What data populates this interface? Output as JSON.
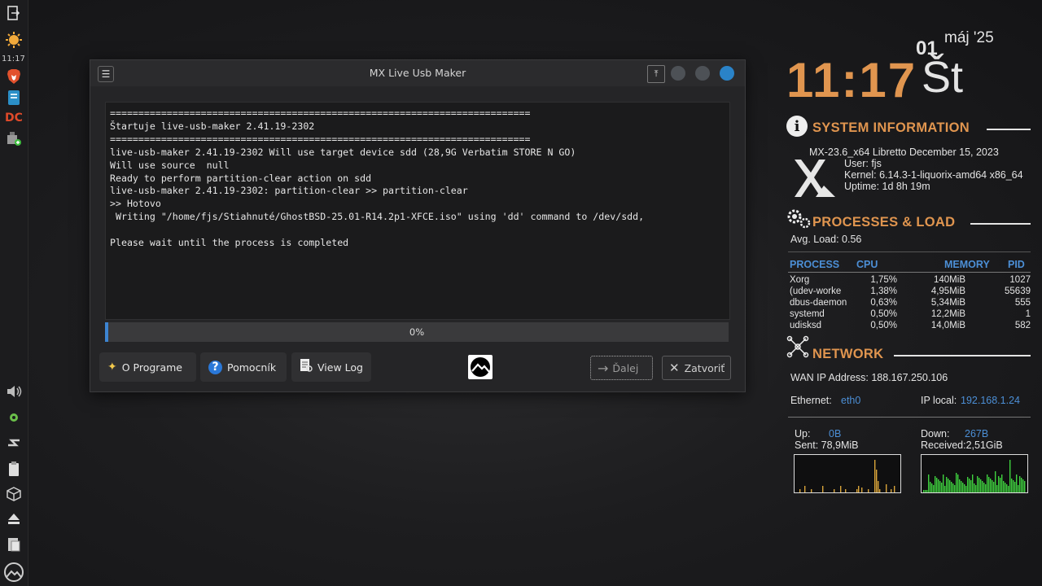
{
  "panel": {
    "clock": "11:17",
    "icons": [
      "logout-icon",
      "weather-sun-icon",
      "brave-browser-icon",
      "notes-app-icon",
      "double-commander-icon",
      "usb-installer-icon",
      "volume-icon",
      "settings-gear-icon",
      "network-icon",
      "clipboard-icon",
      "package-icon",
      "eject-icon",
      "file-manager-icon",
      "mx-logo-icon"
    ]
  },
  "window": {
    "title": "MX Live Usb Maker",
    "console_lines": [
      "==========================================================================",
      "Štartuje live-usb-maker 2.41.19-2302",
      "==========================================================================",
      "live-usb-maker 2.41.19-2302 Will use target device sdd (28,9G Verbatim STORE N GO)",
      "Will use source  null",
      "Ready to perform partition-clear action on sdd",
      "live-usb-maker 2.41.19-2302: partition-clear >> partition-clear",
      ">> Hotovo",
      " Writing \"/home/fjs/Stiahnuté/GhostBSD-25.01-R14.2p1-XFCE.iso\" using 'dd' command to /dev/sdd,",
      "",
      "Please wait until the process is completed"
    ],
    "progress": {
      "value": 0,
      "label": "0%"
    },
    "buttons": {
      "about": "O Programe",
      "help": "Pomocník",
      "view_log": "View Log",
      "next": "Ďalej",
      "close": "Zatvoriť"
    },
    "accent": "#2a83c8"
  },
  "conky": {
    "time": "11:17",
    "day_abbr": "Št",
    "day_num": "01",
    "month_year": "máj '25",
    "system": {
      "heading": "SYSTEM INFORMATION",
      "os": "MX-23.6_x64 Libretto December 15, 2023",
      "user": "User: fjs",
      "kernel": "Kernel: 6.14.3-1-liquorix-amd64 x86_64",
      "uptime": "Uptime: 1d 8h 19m"
    },
    "processes": {
      "heading": "PROCESSES & LOAD",
      "avg_load": "Avg. Load: 0.56",
      "columns": [
        "PROCESS",
        "CPU",
        "MEMORY",
        "PID"
      ],
      "rows": [
        [
          "Xorg",
          "1,75%",
          "140MiB",
          "1027"
        ],
        [
          "(udev-worke",
          "1,38%",
          "4,95MiB",
          "55639"
        ],
        [
          "dbus-daemon",
          "0,63%",
          "5,34MiB",
          "555"
        ],
        [
          "systemd",
          "0,50%",
          "12,2MiB",
          "1"
        ],
        [
          "udisksd",
          "0,50%",
          "14,0MiB",
          "582"
        ]
      ]
    },
    "network": {
      "heading": "NETWORK",
      "wan": "WAN IP Address: 188.167.250.106",
      "ethernet_label": "Ethernet:",
      "ethernet_value": "eth0",
      "ip_label": "IP local:",
      "ip_value": "192.168.1.24",
      "up_label": "Up:",
      "up_value": "0B",
      "sent": "Sent: 78,9MiB",
      "down_label": "Down:",
      "down_value": "267B",
      "received": "Received:2,51GiB"
    },
    "colors": {
      "orange": "#e0954f",
      "blue": "#4c8fd6",
      "up_graph": "#d9a53a",
      "down_graph": "#3fd23f"
    }
  }
}
